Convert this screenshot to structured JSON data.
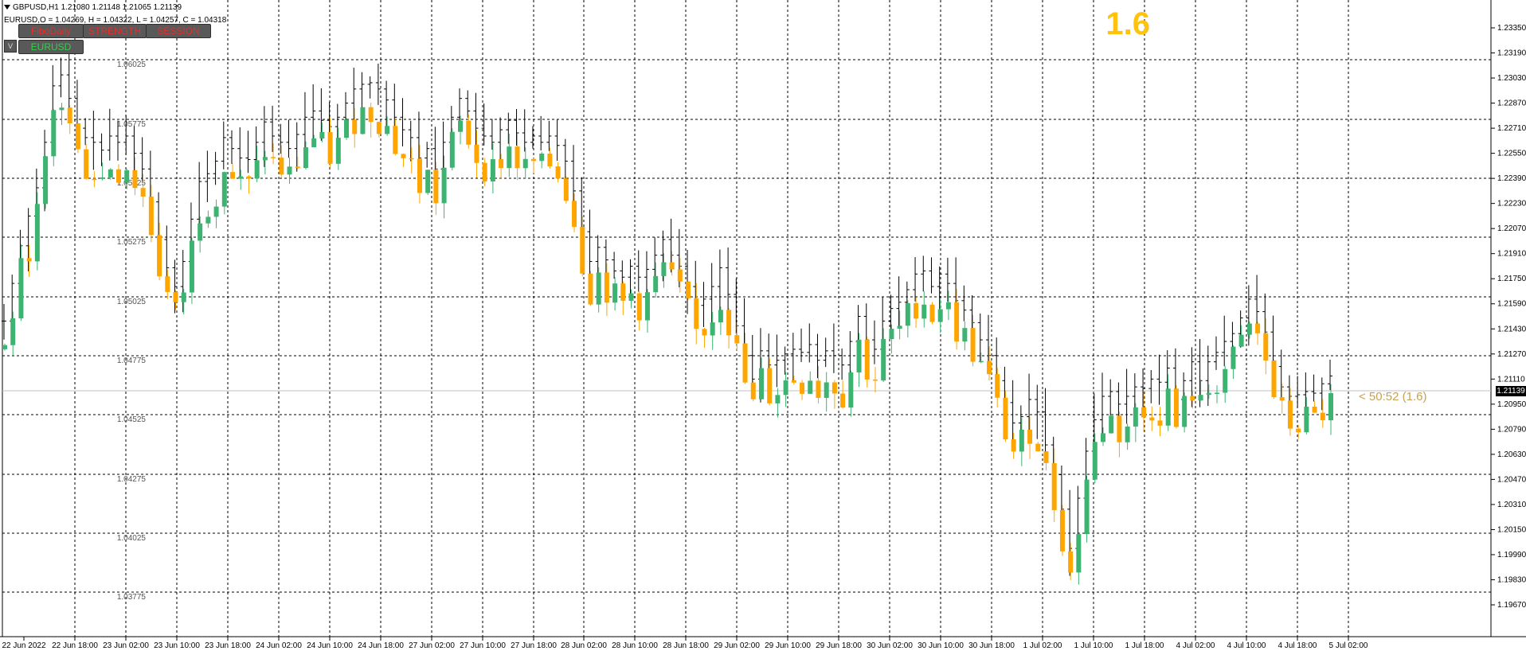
{
  "header": {
    "title": "GBPUSD,H1  1.21080 1.21148 1.21065 1.21139",
    "subtitle": "EURUSD,O = 1.04269, H = 1.04322, L = 1.04257, C = 1.04318"
  },
  "buttons": {
    "fibo_daily": "FiboDaily",
    "strength": "STRENGTH",
    "session": "SESSION",
    "eurusd": "EURUSD",
    "v": "V"
  },
  "indicator": {
    "big_value": "1.6",
    "timer_label": "< 50:52 (1.6)",
    "current_price": "1.21139"
  },
  "colors": {
    "background": "#ffffff",
    "grid": "#000000",
    "gbpusd_bar": "#000000",
    "eurusd_bull": "#3cb371",
    "eurusd_bear": "#ffa500",
    "big_value": "#ffc20e",
    "timer": "#c8a052",
    "button_bg": "#595959",
    "button_red_text": "#e0312f",
    "button_green_text": "#32d04a"
  },
  "chart_data": {
    "type": "candlestick",
    "symbol": "GBPUSD",
    "timeframe": "H1",
    "overlay_symbol": "EURUSD",
    "y_ticks": [
      "1.23350",
      "1.23190",
      "1.23030",
      "1.22870",
      "1.22710",
      "1.22550",
      "1.22390",
      "1.22230",
      "1.22070",
      "1.21910",
      "1.21750",
      "1.21590",
      "1.21430",
      "1.21270",
      "1.21110",
      "1.20950",
      "1.20790",
      "1.20630",
      "1.20470",
      "1.20310",
      "1.20150",
      "1.19990",
      "1.19830",
      "1.19670"
    ],
    "overlay_ticks": [
      "1.06025",
      "1.05775",
      "1.05525",
      "1.05275",
      "1.05025",
      "1.04775",
      "1.04525",
      "1.04275",
      "1.04025",
      "1.03775"
    ],
    "x_ticks": [
      "22 Jun 2022",
      "22 Jun 18:00",
      "23 Jun 02:00",
      "23 Jun 10:00",
      "23 Jun 18:00",
      "24 Jun 02:00",
      "24 Jun 10:00",
      "24 Jun 18:00",
      "27 Jun 02:00",
      "27 Jun 10:00",
      "27 Jun 18:00",
      "28 Jun 02:00",
      "28 Jun 10:00",
      "28 Jun 18:00",
      "29 Jun 02:00",
      "29 Jun 10:00",
      "29 Jun 18:00",
      "30 Jun 02:00",
      "30 Jun 10:00",
      "30 Jun 18:00",
      "1 Jul 02:00",
      "1 Jul 10:00",
      "1 Jul 18:00",
      "4 Jul 02:00",
      "4 Jul 10:00",
      "4 Jul 18:00",
      "5 Jul 02:00"
    ],
    "gbpusd_path": [
      1.2148,
      1.2172,
      1.2196,
      1.2215,
      1.2233,
      1.2262,
      1.2298,
      1.2305,
      1.229,
      1.2271,
      1.2265,
      1.2262,
      1.2257,
      1.2266,
      1.2262,
      1.2266,
      1.2255,
      1.2245,
      1.2224,
      1.22,
      1.2182,
      1.217,
      1.2186,
      1.2213,
      1.2237,
      1.2242,
      1.225,
      1.2265,
      1.2258,
      1.2252,
      1.2251,
      1.2262,
      1.2275,
      1.2266,
      1.2262,
      1.2258,
      1.2267,
      1.2278,
      1.2282,
      1.2276,
      1.2272,
      1.2278,
      1.2287,
      1.2296,
      1.2299,
      1.23,
      1.2296,
      1.2289,
      1.2278,
      1.227,
      1.2265,
      1.2252,
      1.2258,
      1.2245,
      1.2262,
      1.2278,
      1.229,
      1.2282,
      1.2271,
      1.2266,
      1.2262,
      1.227,
      1.2276,
      1.2268,
      1.2262,
      1.2266,
      1.2262,
      1.2266,
      1.226,
      1.225,
      1.2231,
      1.2205,
      1.2186,
      1.2195,
      1.2187,
      1.218,
      1.2176,
      1.2183,
      1.2176,
      1.2181,
      1.219,
      1.22,
      1.219,
      1.2183,
      1.217,
      1.2158,
      1.2162,
      1.217,
      1.2182,
      1.2165,
      1.2145,
      1.2126,
      1.2111,
      1.2129,
      1.212,
      1.2123,
      1.2127,
      1.213,
      1.2128,
      1.2133,
      1.2123,
      1.2129,
      1.2126,
      1.212,
      1.2135,
      1.2151,
      1.2136,
      1.213,
      1.2148,
      1.2156,
      1.216,
      1.2168,
      1.2178,
      1.218,
      1.217,
      1.2178,
      1.2172,
      1.2161,
      1.2155,
      1.2147,
      1.2136,
      1.2126,
      1.211,
      1.2096,
      1.2083,
      1.2087,
      1.2098,
      1.209,
      1.2069,
      1.205,
      1.2028,
      1.2003,
      1.2035,
      1.2065,
      1.2085,
      1.21,
      1.2103,
      1.2095,
      1.21,
      1.2106,
      1.2105,
      1.2111,
      1.2109,
      1.2118,
      1.2098,
      1.211,
      1.2122,
      1.211,
      1.2122,
      1.2128,
      1.2135,
      1.214,
      1.215,
      1.2162,
      1.2154,
      1.2141,
      1.2119,
      1.2106,
      1.21,
      1.2101,
      1.2103,
      1.2102,
      1.2108,
      1.2113
    ]
  }
}
